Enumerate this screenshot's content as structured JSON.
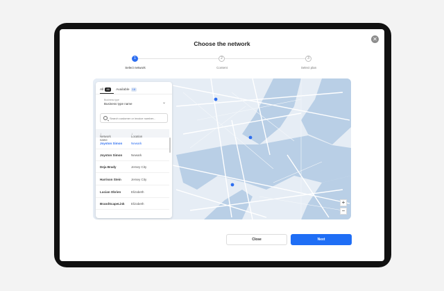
{
  "dialog": {
    "title": "Choose the network"
  },
  "stepper": [
    {
      "number": "1",
      "label": "Select network",
      "active": true
    },
    {
      "number": "2",
      "label": "Content",
      "active": false
    },
    {
      "number": "3",
      "label": "Select plan",
      "active": false
    }
  ],
  "panel": {
    "tabs": [
      {
        "label": "All",
        "count": "46"
      },
      {
        "label": "Available",
        "count": "18"
      }
    ],
    "business_type": {
      "label": "Business type",
      "value": "Business type name"
    },
    "search": {
      "placeholder": "Search customer or invoice number..."
    },
    "columns": {
      "network_name": "Network name",
      "location": "Location"
    },
    "rows": [
      {
        "name": "Joyston Simon",
        "location": "Newark",
        "selected": true
      },
      {
        "name": "Joyston Simon",
        "location": "Newark",
        "selected": false
      },
      {
        "name": "Deja Brady",
        "location": "Jersey City",
        "selected": false
      },
      {
        "name": "Harrison Stein",
        "location": "Jersey City",
        "selected": false
      },
      {
        "name": "Lucian Obrien",
        "location": "Elizabeth",
        "selected": false
      },
      {
        "name": "BrandScapeLink",
        "location": "Elizabeth",
        "selected": false
      }
    ]
  },
  "map": {
    "zoom_in": "+",
    "zoom_out": "−",
    "pin_color": "#2d6ef0",
    "water_color": "#b9cfe6",
    "land_color": "#e6edf5"
  },
  "footer": {
    "close_label": "Close",
    "next_label": "Next"
  },
  "colors": {
    "accent": "#1f6ef5",
    "frame": "#111111"
  }
}
